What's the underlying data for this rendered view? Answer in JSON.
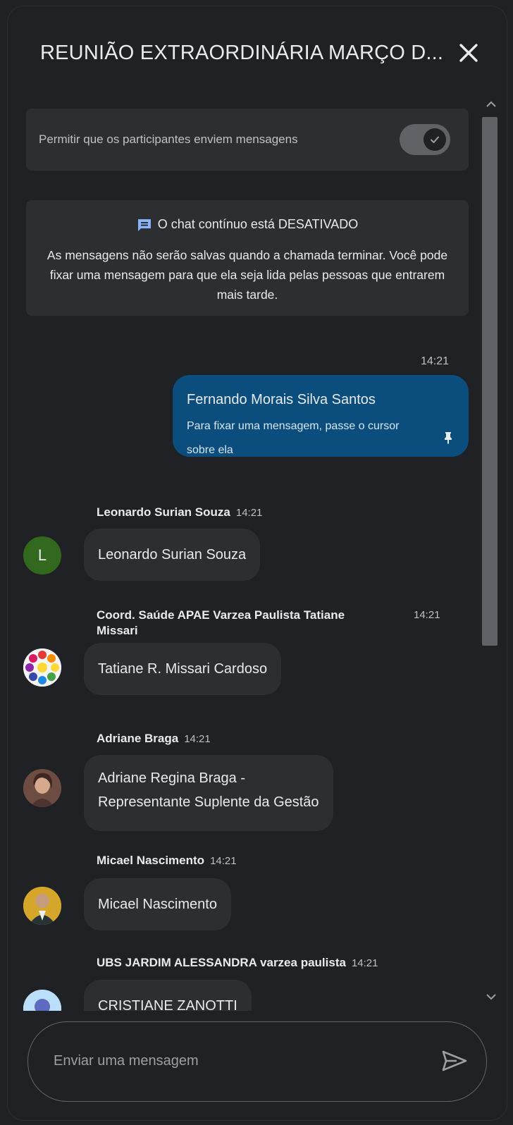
{
  "header": {
    "title": "REUNIÃO EXTRAORDINÁRIA MARÇO D...",
    "close_icon": "close-icon"
  },
  "settings": {
    "allow_messages_label": "Permitir que os participantes enviem mensagens",
    "allow_messages_enabled": true
  },
  "info": {
    "title": "O chat contínuo está DESATIVADO",
    "body": "As mensagens não serão salvas quando a chamada terminar. Você pode fixar uma mensagem para que ela seja lida pelas pessoas que entrarem mais tarde."
  },
  "self_message": {
    "time": "14:21",
    "name": "Fernando Morais Silva Santos",
    "text": "Para fixar uma mensagem, passe o cursor sobre ela",
    "bubble_color": "#0b4e7e"
  },
  "messages": [
    {
      "sender": "Leonardo Surian Souza",
      "time": "14:21",
      "text": "Leonardo Surian Souza",
      "avatar_letter": "L",
      "avatar_color": "#33691e"
    },
    {
      "sender": "Coord. Saúde APAE Varzea Paulista Tatiane",
      "sender_line2": "Missari",
      "time": "14:21",
      "text": "Tatiane R. Missari Cardoso"
    },
    {
      "sender": "Adriane Braga",
      "time": "14:21",
      "text_line1": "Adriane Regina Braga -",
      "text_line2": "Representante Suplente da Gestão"
    },
    {
      "sender": "Micael Nascimento",
      "time": "14:21",
      "text": "Micael Nascimento"
    },
    {
      "sender": "UBS JARDIM ALESSANDRA varzea paulista",
      "time": "14:21",
      "text": "CRISTIANE ZANOTTI"
    }
  ],
  "composer": {
    "placeholder": "Enviar uma mensagem",
    "send_icon": "send-icon"
  }
}
